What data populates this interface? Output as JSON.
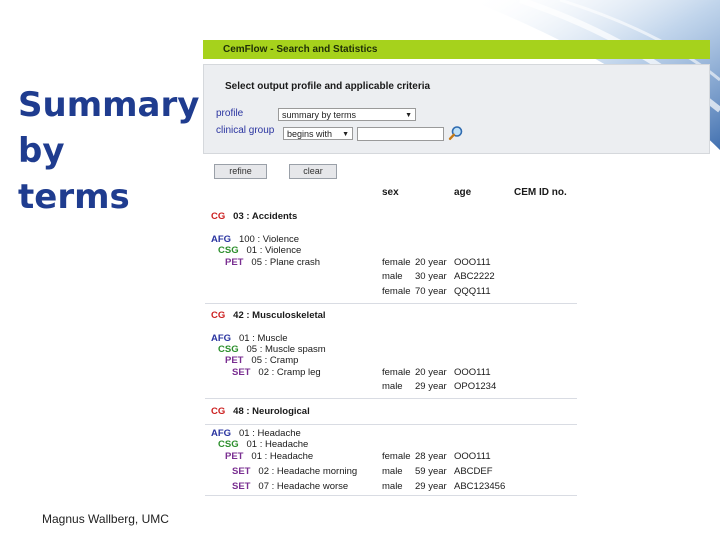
{
  "slide": {
    "title_lines": [
      "Summary",
      "by",
      "terms"
    ],
    "footer": "Magnus Wallberg, UMC"
  },
  "app": {
    "header": "CemFlow - Search and Statistics",
    "criteria_title": "Select output profile and applicable criteria",
    "profile_label": "profile",
    "profile_value": "summary by terms",
    "group_label": "clinical group",
    "group_operator": "begins with",
    "group_value": "",
    "refine_label": "refine",
    "clear_label": "clear",
    "columns": {
      "sex": "sex",
      "age": "age",
      "cem": "CEM ID no."
    }
  },
  "groups": [
    {
      "cg_code": "CG",
      "cg_text": "03 : Accidents",
      "afg_code": "AFG",
      "afg_text": "100 : Violence",
      "csg_code": "CSG",
      "csg_text": "01 : Violence",
      "pet_code": "PET",
      "pet_text": "05 : Plane crash",
      "patients": [
        {
          "sex": "female",
          "age": "20 year",
          "id": "OOO111"
        },
        {
          "sex": "male",
          "age": "30 year",
          "id": "ABC2222"
        },
        {
          "sex": "female",
          "age": "70 year",
          "id": "QQQ111"
        }
      ]
    },
    {
      "cg_code": "CG",
      "cg_text": "42 : Musculoskeletal",
      "afg_code": "AFG",
      "afg_text": "01 : Muscle",
      "csg_code": "CSG",
      "csg_text": "05 : Muscle spasm",
      "pet_code": "PET",
      "pet_text": "05 : Cramp",
      "set_code": "SET",
      "set_text": "02 : Cramp leg",
      "patients": [
        {
          "sex": "female",
          "age": "20 year",
          "id": "OOO111"
        },
        {
          "sex": "male",
          "age": "29 year",
          "id": "OPO1234"
        }
      ]
    },
    {
      "cg_code": "CG",
      "cg_text": "48 : Neurological",
      "afg_code": "AFG",
      "afg_text": "01 : Headache",
      "csg_code": "CSG",
      "csg_text": "01 : Headache",
      "pet_code": "PET",
      "pet_text": "01 : Headache",
      "set1_code": "SET",
      "set1_text": "02 : Headache morning",
      "set2_code": "SET",
      "set2_text": "07 : Headache worse",
      "patients": [
        {
          "sex": "female",
          "age": "28 year",
          "id": "OOO111"
        },
        {
          "sex": "male",
          "age": "59 year",
          "id": "ABCDEF"
        },
        {
          "sex": "male",
          "age": "29 year",
          "id": "ABC123456"
        }
      ]
    }
  ],
  "colors": {
    "title_blue": "#1f3c8f",
    "header_green": "#a6d21c",
    "cg_red": "#cc1f1f",
    "afg_blue": "#2a34a0",
    "csg_green": "#2d8f2d",
    "pet_purple": "#7a2f91"
  }
}
